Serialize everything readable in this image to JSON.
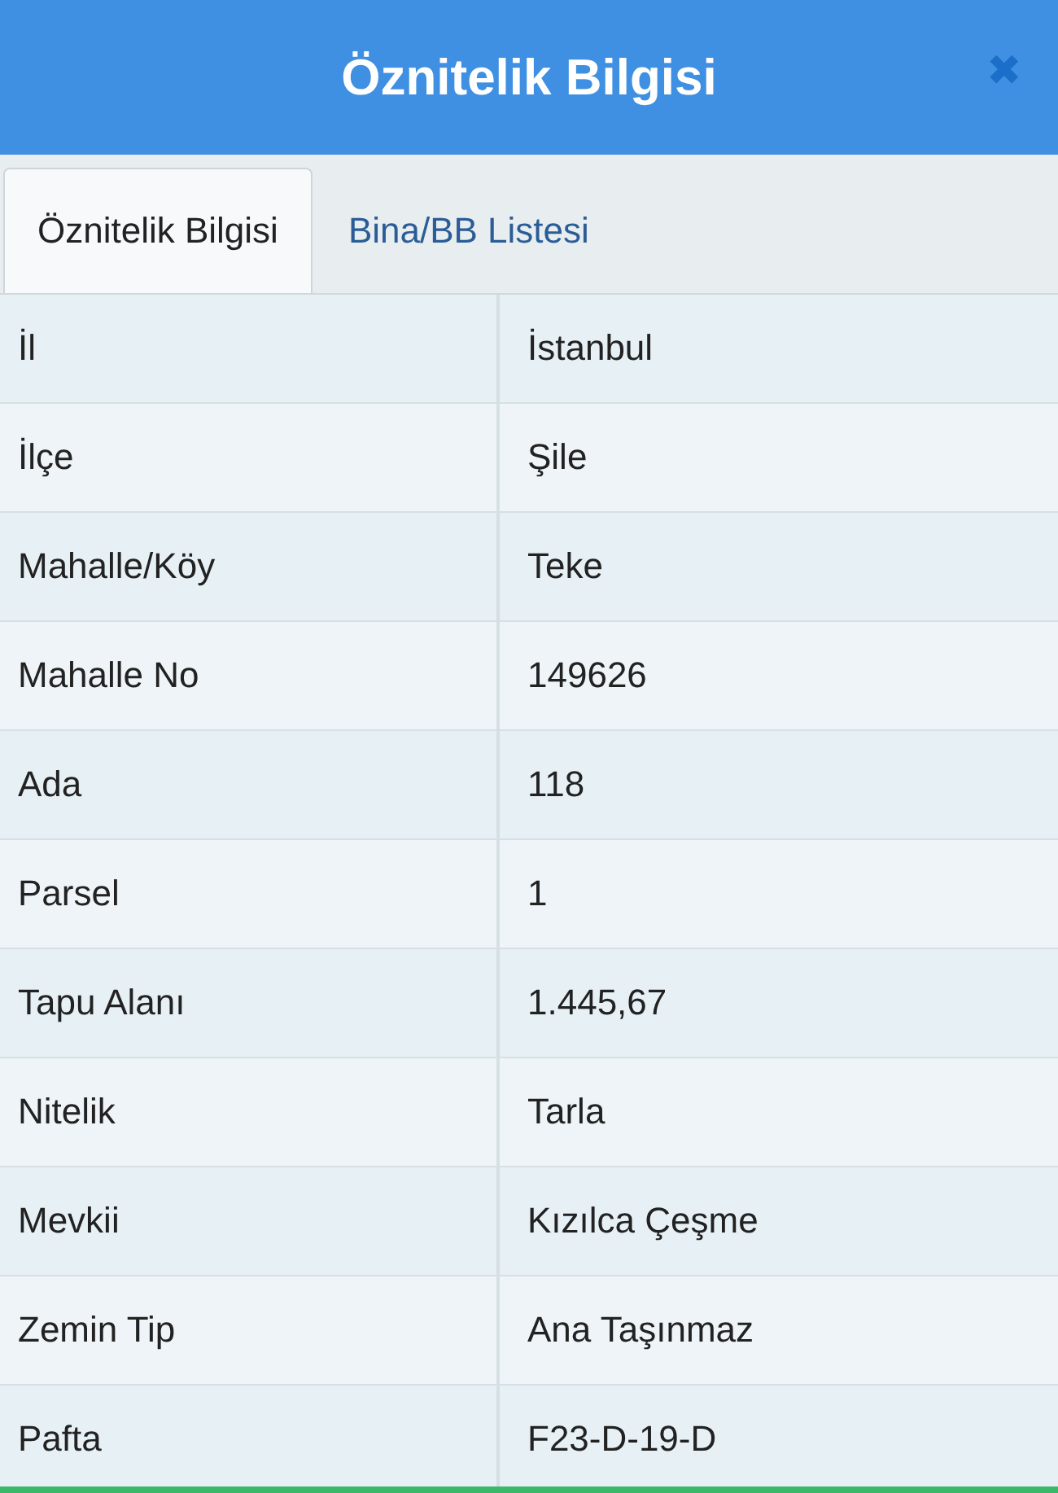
{
  "window": {
    "title": "Öznitelik Bilgisi",
    "close": "✖"
  },
  "tabs": [
    {
      "label": "Öznitelik Bilgisi",
      "selected": true
    },
    {
      "label": "Bina/BB Listesi",
      "selected": false
    }
  ],
  "rows": [
    {
      "label": "İl",
      "value": "İstanbul"
    },
    {
      "label": "İlçe",
      "value": "Şile"
    },
    {
      "label": "Mahalle/Köy",
      "value": "Teke"
    },
    {
      "label": "Mahalle No",
      "value": "149626"
    },
    {
      "label": "Ada",
      "value": "118"
    },
    {
      "label": "Parsel",
      "value": "1"
    },
    {
      "label": "Tapu Alanı",
      "value": "1.445,67"
    },
    {
      "label": "Nitelik",
      "value": "Tarla"
    },
    {
      "label": "Mevkii",
      "value": "Kızılca Çeşme"
    },
    {
      "label": "Zemin Tip",
      "value": "Ana Taşınmaz"
    },
    {
      "label": "Pafta",
      "value": "F23-D-19-D"
    }
  ]
}
